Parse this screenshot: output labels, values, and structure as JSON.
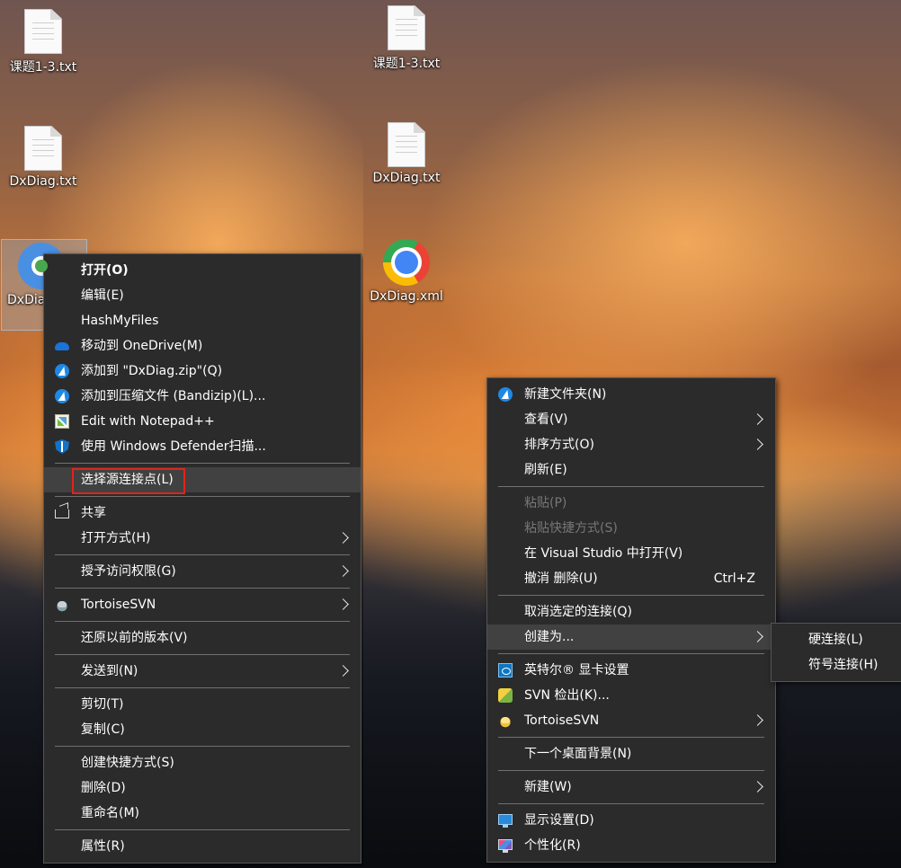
{
  "left_desktop": {
    "icons": [
      {
        "label": "课题1-3.txt"
      },
      {
        "label": "DxDiag.txt"
      },
      {
        "label": "DxDiag.xml"
      }
    ],
    "context_menu": [
      {
        "type": "item",
        "label": "打开(O)",
        "bold": true
      },
      {
        "type": "item",
        "label": "编辑(E)"
      },
      {
        "type": "item",
        "label": "HashMyFiles"
      },
      {
        "type": "item",
        "label": "移动到 OneDrive(M)",
        "icon": "onedrive-icon"
      },
      {
        "type": "item",
        "label": "添加到 \"DxDiag.zip\"(Q)",
        "icon": "bandizip-icon"
      },
      {
        "type": "item",
        "label": "添加到压缩文件 (Bandizip)(L)...",
        "icon": "bandizip-icon"
      },
      {
        "type": "item",
        "label": "Edit with Notepad++",
        "icon": "notepadpp-icon"
      },
      {
        "type": "item",
        "label": "使用 Windows Defender扫描...",
        "icon": "defender-icon"
      },
      {
        "type": "sep"
      },
      {
        "type": "item",
        "label": "选择源连接点(L)",
        "highlighted": true,
        "red_box": true
      },
      {
        "type": "sep"
      },
      {
        "type": "item",
        "label": "共享",
        "icon": "share-icon"
      },
      {
        "type": "item",
        "label": "打开方式(H)",
        "submenu": true
      },
      {
        "type": "sep"
      },
      {
        "type": "item",
        "label": "授予访问权限(G)",
        "submenu": true
      },
      {
        "type": "sep"
      },
      {
        "type": "item",
        "label": "TortoiseSVN",
        "icon": "tortoisesvn-icon",
        "submenu": true
      },
      {
        "type": "sep"
      },
      {
        "type": "item",
        "label": "还原以前的版本(V)"
      },
      {
        "type": "sep"
      },
      {
        "type": "item",
        "label": "发送到(N)",
        "submenu": true
      },
      {
        "type": "sep"
      },
      {
        "type": "item",
        "label": "剪切(T)"
      },
      {
        "type": "item",
        "label": "复制(C)"
      },
      {
        "type": "sep"
      },
      {
        "type": "item",
        "label": "创建快捷方式(S)"
      },
      {
        "type": "item",
        "label": "删除(D)"
      },
      {
        "type": "item",
        "label": "重命名(M)"
      },
      {
        "type": "sep"
      },
      {
        "type": "item",
        "label": "属性(R)"
      }
    ]
  },
  "right_desktop": {
    "icons": [
      {
        "label": "课题1-3.txt"
      },
      {
        "label": "DxDiag.txt"
      },
      {
        "label": "DxDiag.xml"
      }
    ],
    "context_menu": [
      {
        "type": "item",
        "label": "新建文件夹(N)",
        "icon": "bandizip-icon"
      },
      {
        "type": "item",
        "label": "查看(V)",
        "submenu": true
      },
      {
        "type": "item",
        "label": "排序方式(O)",
        "submenu": true
      },
      {
        "type": "item",
        "label": "刷新(E)"
      },
      {
        "type": "sep"
      },
      {
        "type": "item",
        "label": "粘贴(P)",
        "disabled": true
      },
      {
        "type": "item",
        "label": "粘贴快捷方式(S)",
        "disabled": true
      },
      {
        "type": "item",
        "label": "在 Visual Studio 中打开(V)"
      },
      {
        "type": "item",
        "label": "撤消 删除(U)",
        "shortcut": "Ctrl+Z"
      },
      {
        "type": "sep"
      },
      {
        "type": "item",
        "label": "取消选定的连接(Q)"
      },
      {
        "type": "item",
        "label": "创建为...",
        "submenu": true,
        "highlighted": true
      },
      {
        "type": "sep"
      },
      {
        "type": "item",
        "label": "英特尔® 显卡设置",
        "icon": "intel-graphics-icon"
      },
      {
        "type": "item",
        "label": "SVN 检出(K)...",
        "icon": "svn-checkout-icon"
      },
      {
        "type": "item",
        "label": "TortoiseSVN",
        "icon": "tortoisesvn-icon",
        "submenu": true
      },
      {
        "type": "sep"
      },
      {
        "type": "item",
        "label": "下一个桌面背景(N)"
      },
      {
        "type": "sep"
      },
      {
        "type": "item",
        "label": "新建(W)",
        "submenu": true
      },
      {
        "type": "sep"
      },
      {
        "type": "item",
        "label": "显示设置(D)",
        "icon": "display-settings-icon"
      },
      {
        "type": "item",
        "label": "个性化(R)",
        "icon": "personalize-icon"
      }
    ],
    "submenu": [
      {
        "label": "硬连接(L)"
      },
      {
        "label": "符号连接(H)"
      }
    ]
  }
}
